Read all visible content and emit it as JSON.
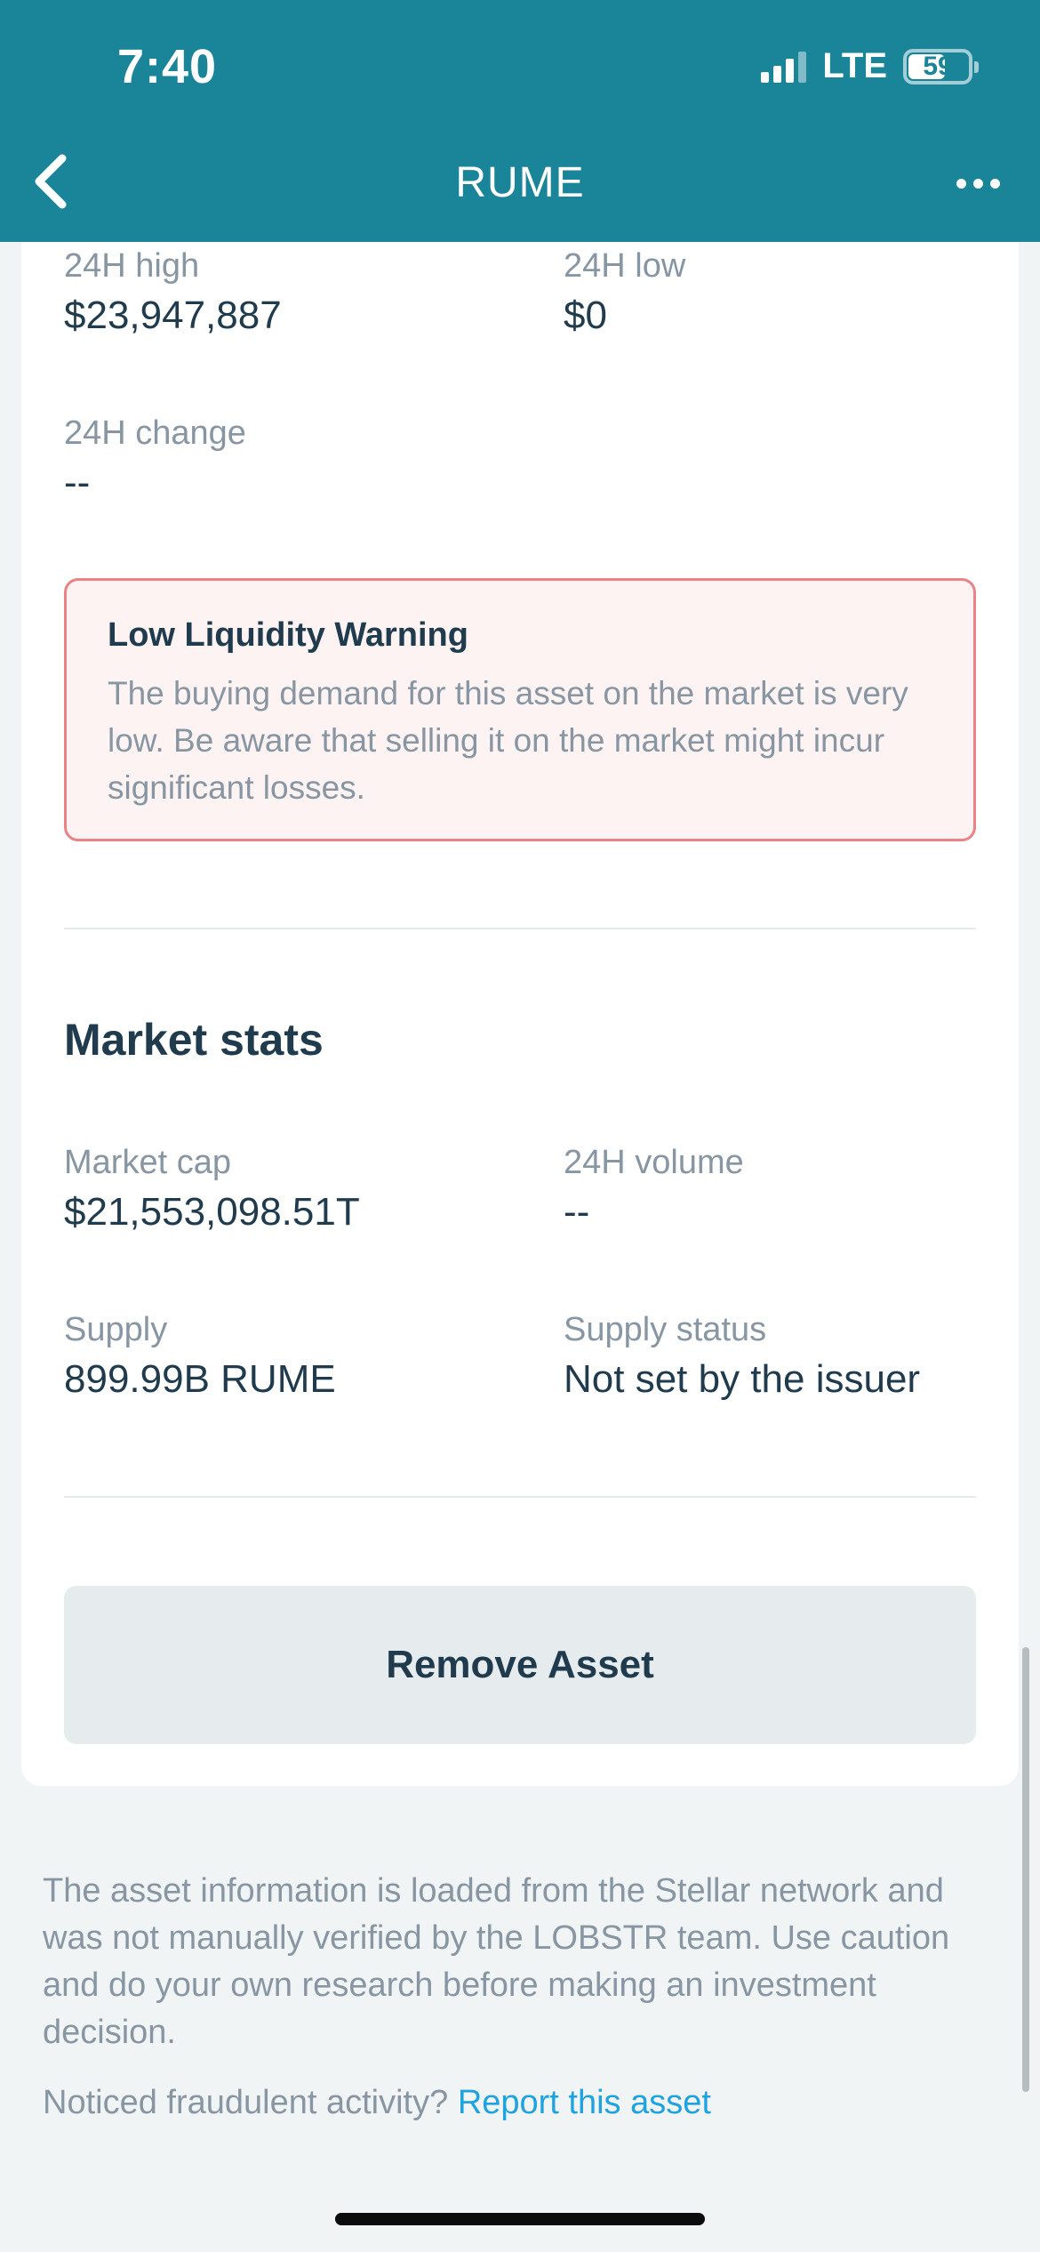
{
  "status_bar": {
    "time": "7:40",
    "network": "LTE",
    "battery": "59",
    "battery_level_percent": 59
  },
  "nav": {
    "title": "RUME",
    "back_icon": "chevron-left-icon",
    "more_icon": "more-horizontal-icon"
  },
  "price_stats": {
    "high_label": "24H high",
    "high_value": "$23,947,887",
    "low_label": "24H low",
    "low_value": "$0",
    "change_label": "24H change",
    "change_value": "--"
  },
  "warning": {
    "title": "Low Liquidity Warning",
    "body": "The buying demand for this asset on the market is very low. Be aware that selling it on the market might incur significant losses."
  },
  "market_stats": {
    "title": "Market stats",
    "market_cap_label": "Market cap",
    "market_cap_value": "$21,553,098.51T",
    "volume_label": "24H volume",
    "volume_value": "--",
    "supply_label": "Supply",
    "supply_value": "899.99B RUME",
    "supply_status_label": "Supply status",
    "supply_status_value": "Not set by the issuer"
  },
  "actions": {
    "remove_label": "Remove Asset"
  },
  "footer": {
    "disclaimer": "The asset information is loaded from the Stellar network and was not manually verified by the LOBSTR team. Use caution and do your own research before making an investment decision.",
    "fraud_prompt": "Noticed fraudulent activity?",
    "report_link": "Report this asset"
  },
  "colors": {
    "header": "#1a8499",
    "warning_border": "#e98387",
    "warning_bg": "#fef3f3",
    "link": "#1ea3e0",
    "text_primary": "#1f3b4d",
    "text_secondary": "#8796a2"
  }
}
